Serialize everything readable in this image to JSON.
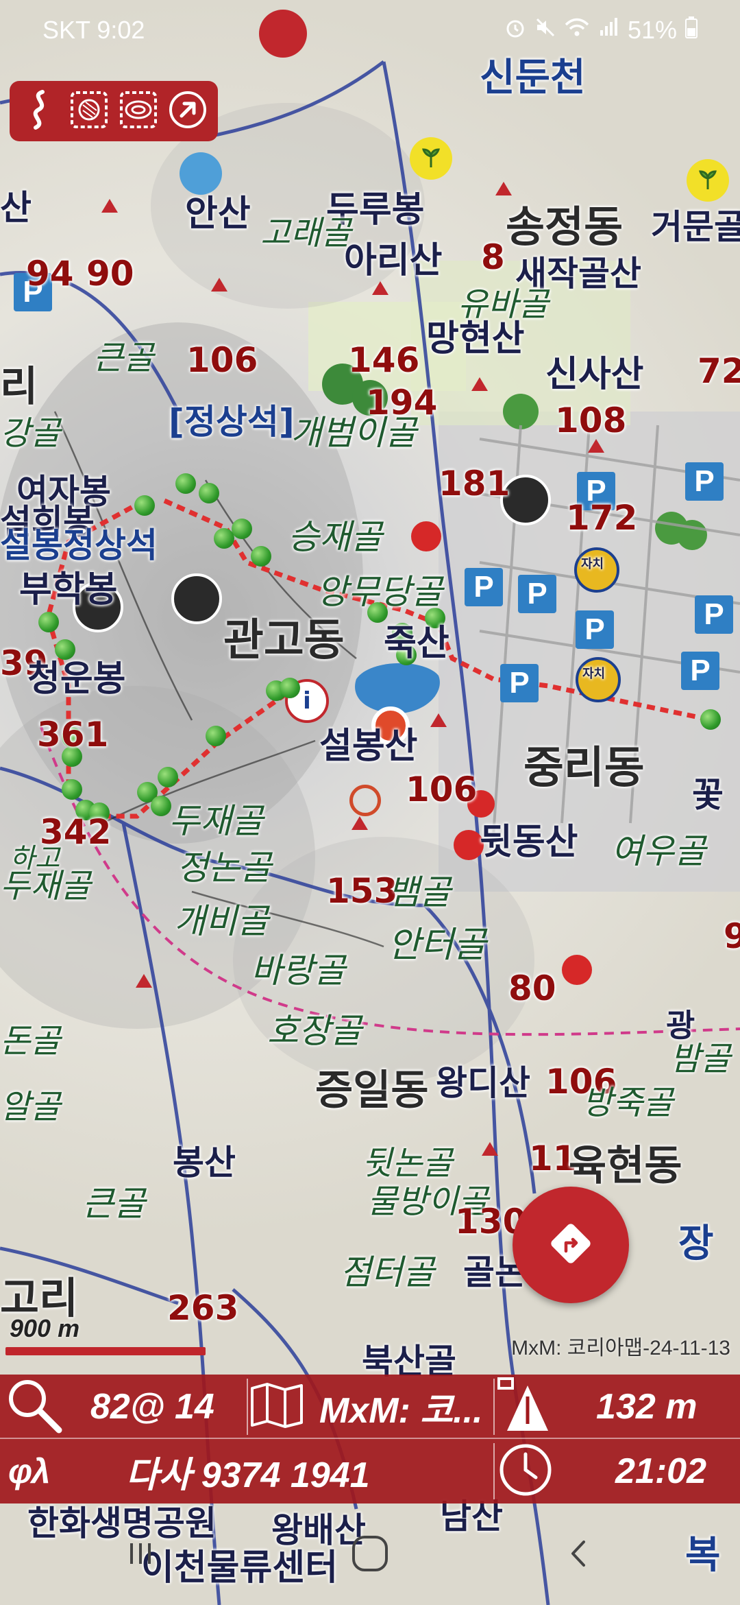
{
  "status_bar": {
    "carrier_time": "SKT 9:02",
    "battery": "51%",
    "icons": [
      "alarm-icon",
      "mute-icon",
      "wifi-icon",
      "signal-icon",
      "battery-icon"
    ]
  },
  "toolbar": {
    "icons": [
      "track-icon",
      "layer-icon",
      "overlay-icon",
      "compass-arrow-icon"
    ]
  },
  "map": {
    "labels": {
      "sinduncheon": "신둔천",
      "ansan": "안산",
      "durubong": "두루봉",
      "goraegol": "고래골",
      "arisan": "아리산",
      "songjeongdong": "송정동",
      "geomungol": "거문골",
      "saejakgolsan": "새작골산",
      "ubaegol": "유바골",
      "manghyeonsan": "망현산",
      "sinsasan": "신사산",
      "num_94": "94",
      "num_90": "90",
      "num_8": "8",
      "num_72": "72",
      "keungol_top": "큰골",
      "num_106a": "106",
      "num_146": "146",
      "num_194": "194",
      "num_108": "108",
      "jeongsangseok": "[정상석]",
      "gaebeomigol": "개범이골",
      "num_181": "181",
      "num_172": "172",
      "yeojabong": "여자봉",
      "seolhuibong": "설희봉",
      "seolbongseok": "설봉정상석",
      "seungjaegol": "승재골",
      "buhakbong": "부학봉",
      "angmudanggol": "앙무당골",
      "gwangodong": "관고동",
      "jooksan": "죽산",
      "num_39": "39",
      "cheongeunbong": "청운봉",
      "num_361": "361",
      "seolbongsan": "설봉산",
      "jungridong": "중리동",
      "num_106b": "106",
      "num_342": "342",
      "dujaegol": "두재골",
      "twitdongsan": "뒷동산",
      "yeougol": "여우골",
      "hago": "하고",
      "dujaegol2": "두재골",
      "jeongnongol": "정논골",
      "gaebigol": "개비골",
      "num_153": "153",
      "baemgol": "뱀골",
      "anteogol": "안터골",
      "baranggol": "바랑골",
      "num_80": "80",
      "hojanggol": "호장골",
      "jeungildong": "증일동",
      "wangdisan": "왕디산",
      "num_106c": "106",
      "bangjukgol": "방죽골",
      "bamgol": "밤골",
      "bongsan": "봉산",
      "twitnongol": "뒷논골",
      "num_11": "11",
      "yukhyeondong": "육현동",
      "keungol_bottom": "큰골",
      "mulbangigol": "물방이골",
      "num_130": "130",
      "jeomteogol": "점터골",
      "golnae": "골논",
      "gori": "고리",
      "num_263": "263",
      "buksangol": "북산골",
      "jang": "장",
      "hanhwa": "한화생명공원",
      "wangbaesan": "왕배산",
      "namsan": "남산",
      "icheon_logistics": "이천물류센터",
      "bok": "복",
      "ri_left": "리",
      "san_left": "산",
      "dongol": "돈골",
      "algol": "알골",
      "kkot": "꽃",
      "gwang": "광",
      "num_9": "9",
      "jachi1": "자치",
      "jachi2": "자치",
      "ganggol": "강골"
    }
  },
  "scale": {
    "text": "900 m"
  },
  "attribution": "MxM: 코리아맵-24-11-13",
  "route_fab": {
    "icon": "route-turn-icon"
  },
  "info_panel": {
    "zoom": "82@ 14",
    "map_name": "MxM: 코...",
    "altitude": "132 m",
    "coords_prefix": "φλ",
    "coords": "다사 9374 1941",
    "time": "21:02"
  },
  "nav_bar": {
    "icons": [
      "recent-apps-icon",
      "home-icon",
      "back-icon"
    ]
  },
  "colors": {
    "accent": "#b12428",
    "track": "#e03030",
    "track_point": "#2f9a2a",
    "parking": "#2f7fc4",
    "peak_number": "#8f0d0d"
  }
}
